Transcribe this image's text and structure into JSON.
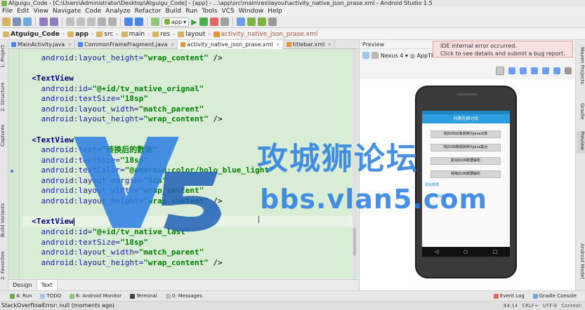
{
  "window": {
    "title": "Atguigu_Code - [C:\\Users\\Administrator\\Desktop\\Atguigu_Code] - [app] - ...\\app\\src\\main\\res\\layout\\activity_native_json_prase.xml - Android Studio 1.5"
  },
  "menu": [
    "File",
    "Edit",
    "View",
    "Navigate",
    "Code",
    "Analyze",
    "Refactor",
    "Build",
    "Run",
    "Tools",
    "VCS",
    "Window",
    "Help"
  ],
  "toolbar": {
    "run_config": "app"
  },
  "breadcrumbs": [
    "Atguigu_Code",
    "app",
    "src",
    "main",
    "res",
    "layout",
    "activity_native_json_prase.xml"
  ],
  "error_tip": {
    "line1": "IDE internal error occurred.",
    "line2": "Click to see details and submit a bug report."
  },
  "editor_tabs": [
    {
      "label": "MainActivity.java",
      "active": false
    },
    {
      "label": "CommonFrameFragment.java",
      "active": false
    },
    {
      "label": "activity_native_json_prase.xml",
      "active": true
    },
    {
      "label": "titlebar.xml",
      "active": false
    }
  ],
  "code": {
    "l1": "android:layout_height=",
    "l1v": "\"wrap_content\"",
    "l1e": " />",
    "l2": "<TextView",
    "l3": "android:id=",
    "l3v": "\"@+id/tv_native_orignal\"",
    "l4": "android:textSize=",
    "l4v": "\"18sp\"",
    "l5": "android:layout_width=",
    "l5v": "\"match_parent\"",
    "l6": "android:layout_height=",
    "l6v": "\"wrap_content\"",
    "l6e": " />",
    "l7": "<TextView",
    "l8": "android:text=",
    "l8v": "\"转换后的数据\"",
    "l9": "android:textSize=",
    "l9v": "\"18sp\"",
    "l10": "android:textColor=",
    "l10v": "\"@android:color/holo_blue_light\"",
    "l11": "android:layout_margin=",
    "l11v": "\"5dp\"",
    "l12": "android:layout_width=",
    "l12v": "\"wrap_content\"",
    "l13": "android:layout_height=",
    "l13v": "\"wrap_content\"",
    "l13e": " />",
    "l14": "<TextView",
    "l15": "android:id=",
    "l15v": "\"@+id/tv_native_last\"",
    "l16": "android:textSize=",
    "l16v": "\"18sp\"",
    "l17": "android:layout_width=",
    "l17v": "\"match_parent\"",
    "l18": "android:layout_height=",
    "l18v": "\"wrap_content\"",
    "l18e": " />"
  },
  "left_tools": [
    "1: Project",
    "2: Structure",
    "Captures",
    "Build Variants",
    "2: Favorites"
  ],
  "right_tools": [
    "Maven Projects",
    "Gradle",
    "Preview",
    "Android Model"
  ],
  "preview": {
    "header": "Preview",
    "device": "Nexus 4",
    "theme": "AppTheme",
    "phone": {
      "title": "问题在即讨论",
      "buttons": [
        "将JSON对象转换为Java对象",
        "将JSON数组转换为Java集合",
        "复杂JSON数据解析",
        "特殊JSON数据解析"
      ],
      "text1": "原始数据",
      "text2": "转换后的数据"
    }
  },
  "design_tabs": [
    {
      "label": "Design",
      "active": false
    },
    {
      "label": "Text",
      "active": true
    }
  ],
  "tool_windows": [
    "4: Run",
    "TODO",
    "6: Android Monitor",
    "Terminal",
    "0: Messages",
    "Event Log",
    "Gradle Console"
  ],
  "status": {
    "message": "StackOverflowError: null (moments ago)",
    "position": "64:14",
    "line_sep": "CRLF÷",
    "encoding": "UTF-8",
    "context": "Context:"
  },
  "watermark": {
    "cn": "攻城狮论坛",
    "url": "bbs.vlan5.com"
  },
  "colors": {
    "editor_bg": "#d8ecd6",
    "tag": "#000080",
    "attr": "#1a1aa6",
    "value": "#008000",
    "watermark": "#2a7de1"
  }
}
